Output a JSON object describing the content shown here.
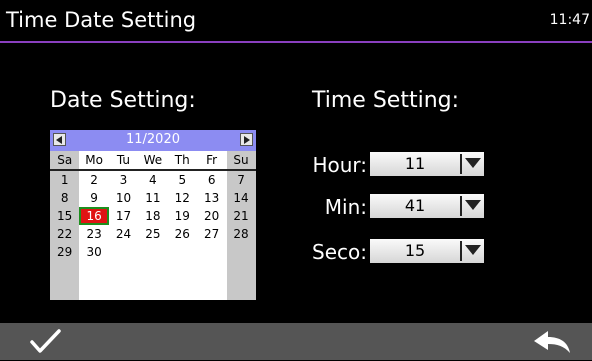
{
  "header": {
    "title": "Time Date Setting",
    "clock": "11:47"
  },
  "date_section": {
    "title": "Date Setting:",
    "calendar": {
      "month_label": "11/2020",
      "weekdays": [
        "Sa",
        "Mo",
        "Tu",
        "We",
        "Th",
        "Fr",
        "Su"
      ],
      "weeks": [
        [
          "1",
          "2",
          "3",
          "4",
          "5",
          "6",
          "7"
        ],
        [
          "8",
          "9",
          "10",
          "11",
          "12",
          "13",
          "14"
        ],
        [
          "15",
          "16",
          "17",
          "18",
          "19",
          "20",
          "21"
        ],
        [
          "22",
          "23",
          "24",
          "25",
          "26",
          "27",
          "28"
        ],
        [
          "29",
          "30",
          "",
          "",
          "",
          "",
          ""
        ]
      ],
      "selected_day": "16"
    }
  },
  "time_section": {
    "title": "Time Setting:",
    "fields": [
      {
        "label": "Hour:",
        "value": "11"
      },
      {
        "label": "Min:",
        "value": "41"
      },
      {
        "label": "Seco:",
        "value": "15"
      }
    ]
  },
  "colors": {
    "accent_line": "#8a3fbf",
    "calendar_header": "#8c8cf2",
    "selected_day": "#e01414",
    "bottom_bar": "#555555"
  },
  "icons": {
    "confirm": "checkmark-icon",
    "back": "back-arrow-icon"
  }
}
